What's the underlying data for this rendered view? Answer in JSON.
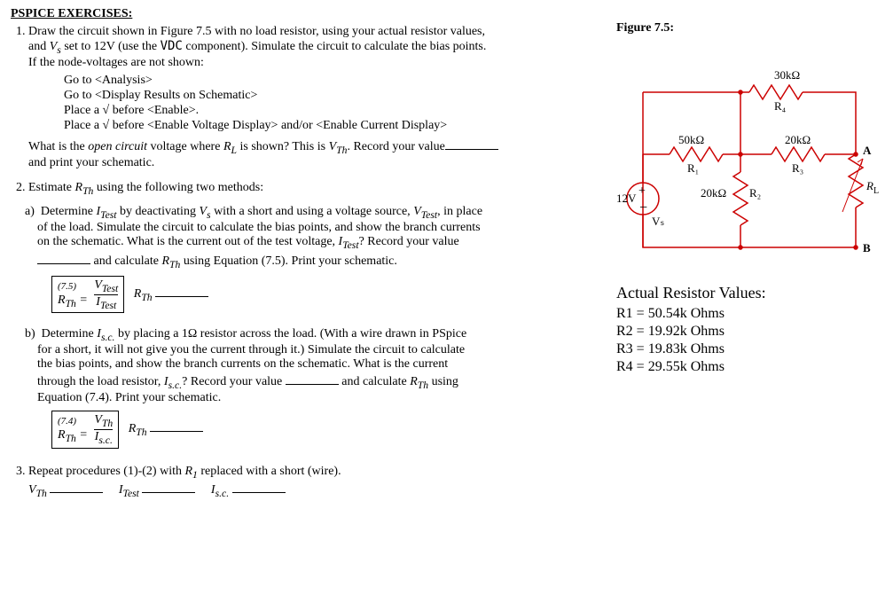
{
  "heading": "PSPICE EXERCISES:",
  "q1": {
    "line1": "Draw the circuit shown in Figure 7.5 with no load resistor, using your actual resistor values,",
    "line2a": "and ",
    "line2b": " set to 12V (use the ",
    "line2c": " component).  Simulate the circuit to calculate the bias points.",
    "vdc": "VDC",
    "line3": "If the node-voltages are not shown:",
    "sub1": "Go to <Analysis>",
    "sub2": "Go to <Display Results on Schematic>",
    "sub3": "Place a √ before <Enable>.",
    "sub4": "Place a √ before <Enable Voltage Display> and/or <Enable Current Display>",
    "what1a": "What is the ",
    "what1oc": "open circuit",
    "what1b": " voltage where ",
    "what1c": " is shown?  This is ",
    "what1d": ". Record your value",
    "what2": "and print your schematic."
  },
  "q2": {
    "intro": "Estimate ",
    "intro2": " using the following two methods:",
    "a1a": "Determine ",
    "a1b": " by deactivating ",
    "a1c": " with a short and using a voltage source, ",
    "a1d": ", in place",
    "a2": "of the load.  Simulate the circuit to calculate the bias points, and show the branch currents",
    "a3a": "on the schematic.  What is the current out of the test voltage, ",
    "a3b": "?  Record your value",
    "a4a": " and calculate ",
    "a4b": " using Equation (7.5).  Print your schematic.",
    "eq75": "(7.5)",
    "b1a": "Determine ",
    "b1b": " by placing a 1Ω resistor across the load.  (With a wire drawn in PSpice",
    "b2": "for a short, it will not give you the current through it.)  Simulate the circuit to calculate",
    "b3": "the bias points, and show the branch currents on the schematic.  What is the current",
    "b4a": "through the load resistor, ",
    "b4b": "?  Record your value ",
    "b4c": " and calculate ",
    "b4d": " using",
    "b5": "Equation (7.4).  Print your schematic.",
    "eq74": "(7.4)"
  },
  "q3": {
    "t1a": "Repeat procedures (1)-(2) with ",
    "t1b": " replaced with a short (wire)."
  },
  "sym": {
    "Vs": "V",
    "Vs_sub": "s",
    "VDC": "VDC",
    "RL": "R",
    "RL_sub": "L",
    "VTh": "V",
    "VTh_sub": "Th",
    "RTh": "R",
    "RTh_sub": "Th",
    "ITest": "I",
    "ITest_sub": "Test",
    "VTest": "V",
    "VTest_sub": "Test",
    "Isc": "I",
    "Isc_sub": "s.c.",
    "R1": "R",
    "R1_sub": "1"
  },
  "fig": {
    "title": "Figure 7.5:",
    "r1": "50kΩ",
    "r1l": "R₁",
    "r2": "20kΩ",
    "r2l": "R₂",
    "r3": "20kΩ",
    "r3l": "R₃",
    "r4": "30kΩ",
    "r4l": "R₄",
    "vs": "12V",
    "vsl": "Vₛ",
    "rl": "R_L",
    "A": "A",
    "B": "B"
  },
  "actual": {
    "title": "Actual Resistor Values:",
    "r1": "R1 = 50.54k Ohms",
    "r2": "R2 = 19.92k Ohms",
    "r3": "R3 = 19.83k Ohms",
    "r4": "R4 = 29.55k Ohms"
  }
}
